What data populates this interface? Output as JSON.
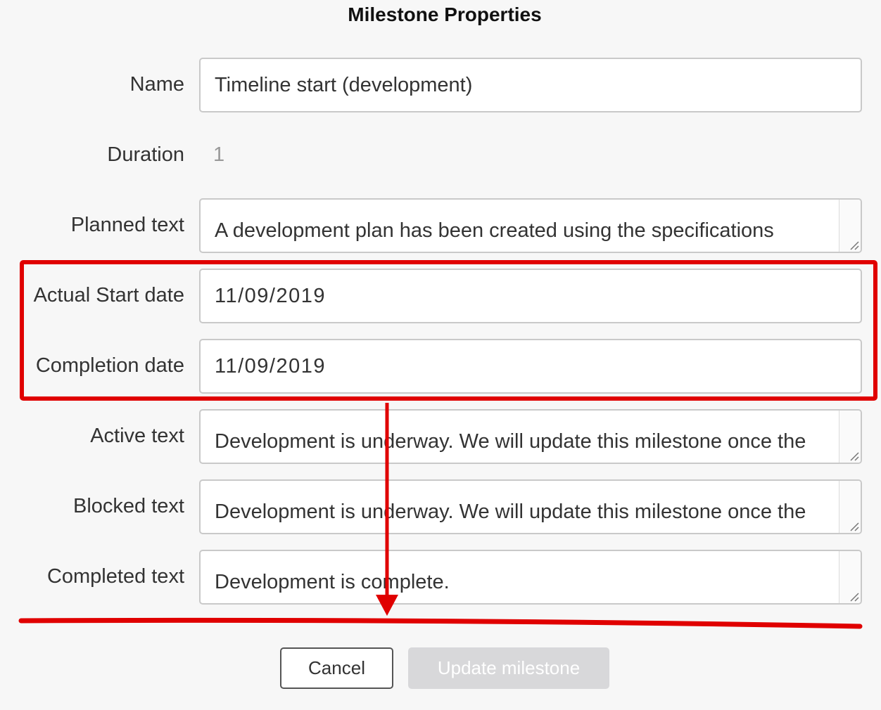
{
  "dialog": {
    "title": "Milestone Properties"
  },
  "fields": {
    "name": {
      "label": "Name",
      "value": "Timeline start (development)"
    },
    "duration": {
      "label": "Duration",
      "value": "1"
    },
    "planned_text": {
      "label": "Planned text",
      "value": "A development plan has been created using the specifications"
    },
    "actual_start_date": {
      "label": "Actual Start date",
      "value": "11/09/2019"
    },
    "completion_date": {
      "label": "Completion date",
      "value": "11/09/2019"
    },
    "active_text": {
      "label": "Active text",
      "value": "Development is underway. We will update this milestone once the"
    },
    "blocked_text": {
      "label": "Blocked text",
      "value": "Development is underway. We will update this milestone once the"
    },
    "completed_text": {
      "label": "Completed text",
      "value": "Development is complete."
    }
  },
  "buttons": {
    "cancel": "Cancel",
    "update": "Update milestone"
  },
  "colors": {
    "annotation_red": "#e00000",
    "disabled_button_bg": "#d8d8da"
  }
}
